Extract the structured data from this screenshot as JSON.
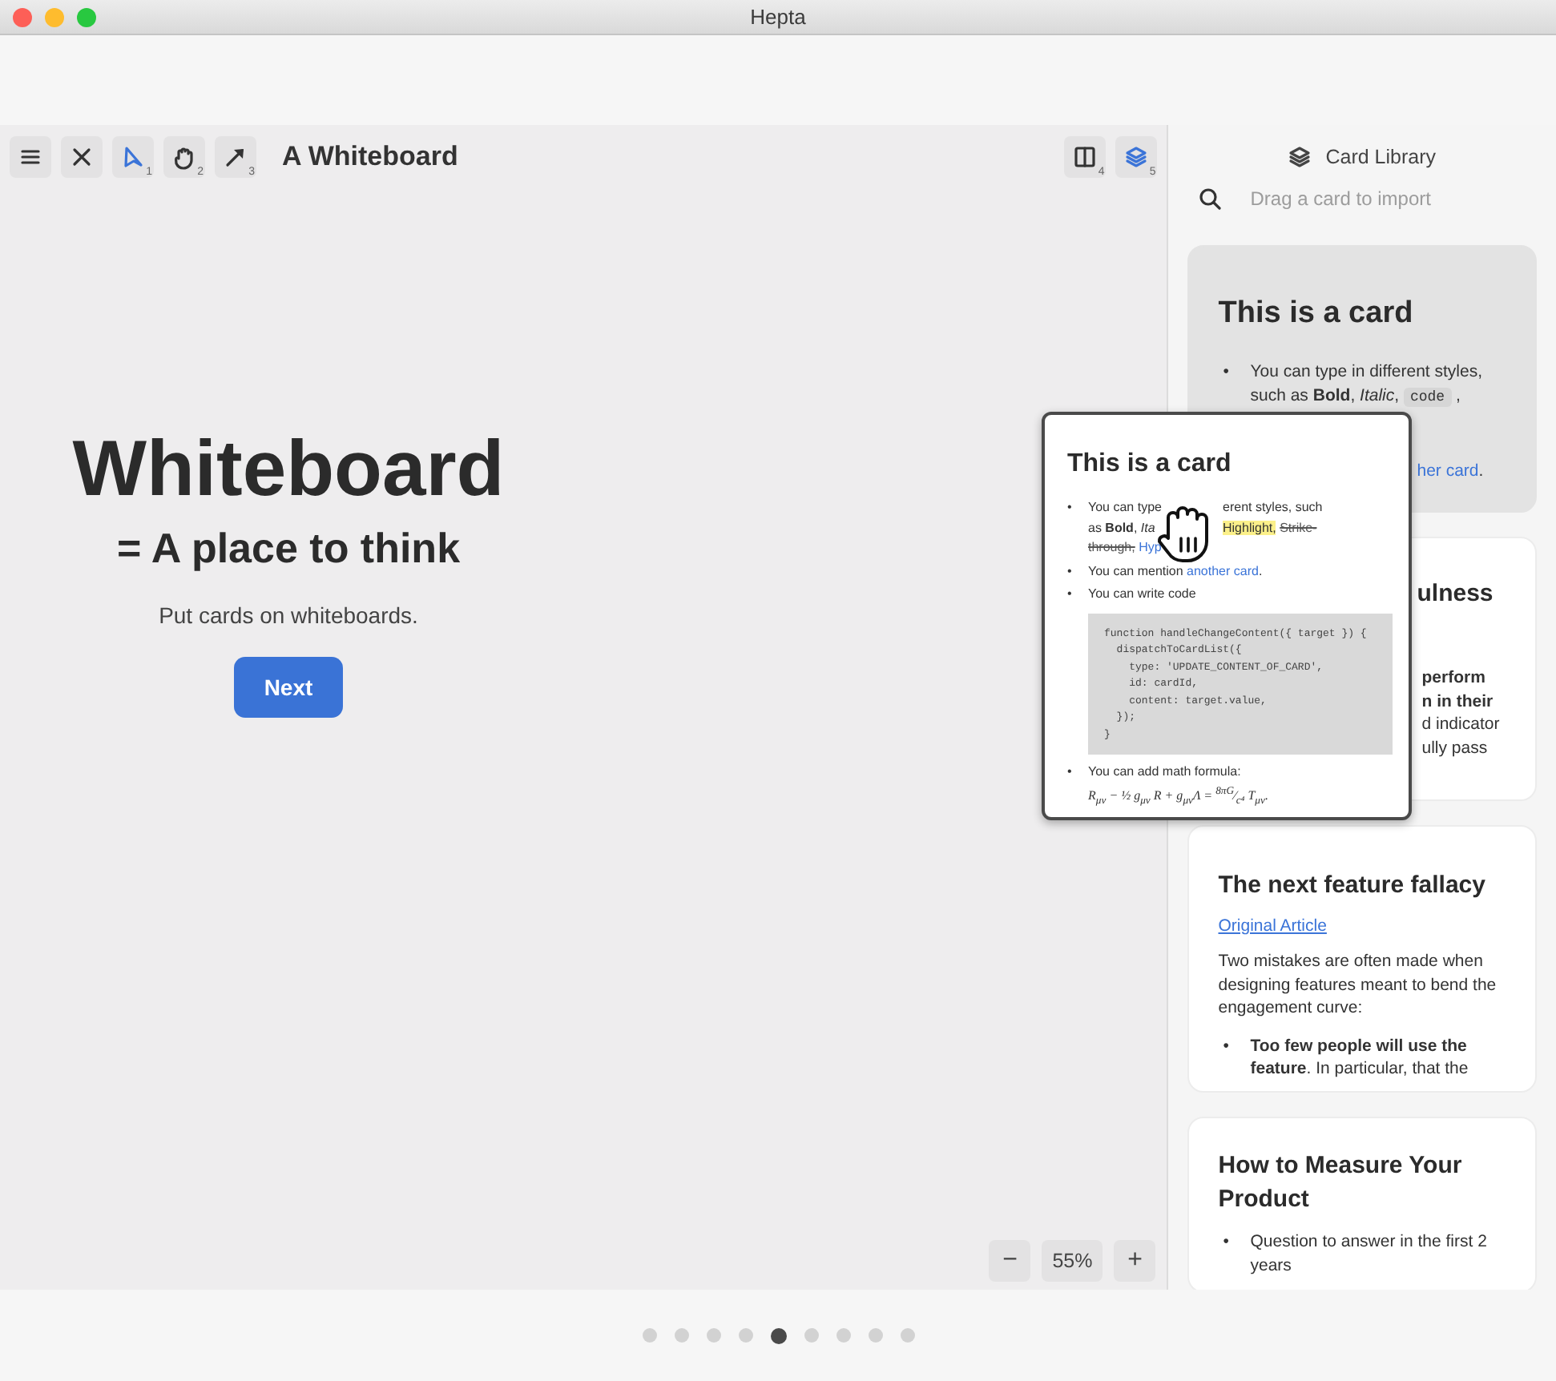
{
  "window": {
    "title": "Hepta"
  },
  "toolbar": {
    "title": "A Whiteboard",
    "tools": [
      {
        "kind": "select",
        "shortcut": "1",
        "selected": true
      },
      {
        "kind": "hand",
        "shortcut": "2",
        "selected": false
      },
      {
        "kind": "arrow",
        "shortcut": "3",
        "selected": false
      }
    ],
    "view_buttons": [
      {
        "kind": "split",
        "shortcut": "4",
        "selected": false
      },
      {
        "kind": "layers",
        "shortcut": "5",
        "selected": true
      }
    ]
  },
  "hero": {
    "title": "Whiteboard",
    "subtitle": "= A place to think",
    "text": "Put cards on whiteboards.",
    "button": "Next"
  },
  "zoom": {
    "minus": "−",
    "value": "55%",
    "plus": "+"
  },
  "library": {
    "title": "Card Library",
    "search": {
      "placeholder": "Drag a card to import"
    },
    "cards": [
      {
        "kind": "source",
        "dragging": true,
        "title": "This is a card",
        "bullets": [
          {
            "marker": "•",
            "parts": [
              {
                "kind": "text",
                "text": "You can type in different styles, such as **Bold**, *Italic*, "
              },
              {
                "kind": "code",
                "text": "code"
              },
              {
                "kind": "text",
                "text": " ,"
              }
            ]
          }
        ],
        "fragments": [
          [
            {
              "kind": "link",
              "text": "her card"
            },
            {
              "kind": "text",
              "text": "."
            }
          ]
        ]
      },
      {
        "kind": "covered",
        "dragging": false,
        "title": "ulness",
        "fragments": [
          [
            {
              "kind": "text",
              "text": "**perform**"
            }
          ],
          [
            {
              "kind": "text",
              "text": "**n in their**"
            }
          ],
          [
            {
              "kind": "text",
              "text": "d indicator"
            }
          ],
          [
            {
              "kind": "text",
              "text": "ully pass"
            }
          ]
        ]
      },
      {
        "kind": "article",
        "dragging": false,
        "title": "The next feature fallacy",
        "link": "Original Article",
        "paragraph": "Two mistakes are often made when designing features meant to bend the engagement curve:",
        "bullets": [
          {
            "marker": "•",
            "parts": [
              {
                "kind": "text",
                "text": "**Too few people will use the feature**. In particular, that the"
              }
            ]
          }
        ]
      },
      {
        "kind": "article",
        "dragging": false,
        "title": "How to Measure Your Product",
        "bullets": [
          {
            "marker": "•",
            "parts": [
              {
                "kind": "text",
                "text": "Question to answer in the first 2 years"
              }
            ]
          }
        ]
      }
    ]
  },
  "dragged_card": {
    "title": "This is a card",
    "bullets": [
      {
        "marker": "•",
        "lines": [
          {
            "before": [
              {
                "kind": "text",
                "text": "You can type"
              }
            ],
            "after": [
              {
                "kind": "text",
                "text": "erent styles, such"
              }
            ]
          },
          {
            "before": [
              {
                "kind": "text",
                "text": "as **Bold**, *Ita*"
              }
            ],
            "after": [
              {
                "kind": "highlight",
                "text": "Highlight,"
              },
              {
                "kind": "strike",
                "text": "Strike-"
              }
            ]
          },
          {
            "before": [
              {
                "kind": "strike",
                "text": "through,"
              },
              {
                "kind": "link",
                "text": "Hyp"
              }
            ]
          }
        ]
      },
      {
        "marker": "•",
        "parts": [
          {
            "kind": "text",
            "text": "You can mention "
          },
          {
            "kind": "link",
            "text": "another card"
          },
          {
            "kind": "text",
            "text": "."
          }
        ]
      },
      {
        "marker": "•",
        "parts": [
          {
            "kind": "text",
            "text": "You can write code"
          }
        ],
        "code": [
          "function handleChangeContent({ target }) {",
          "  dispatchToCardList({",
          "    type: 'UPDATE_CONTENT_OF_CARD',",
          "    id: cardId,",
          "    content: target.value,",
          "  });",
          "}"
        ]
      },
      {
        "marker": "•",
        "parts": [
          {
            "kind": "text",
            "text": "You can add math formula:"
          }
        ],
        "formula": "R$_{μν}$ − ½ g$_{μν}$ R + g$_{μν}$Λ = $^{8πG}$⁄$_{c⁴}$ T$_{μν}$."
      }
    ]
  },
  "pager": [
    {
      "selected": false
    },
    {
      "selected": false
    },
    {
      "selected": false
    },
    {
      "selected": false
    },
    {
      "selected": true
    },
    {
      "selected": false
    },
    {
      "selected": false
    },
    {
      "selected": false
    },
    {
      "selected": false
    }
  ]
}
